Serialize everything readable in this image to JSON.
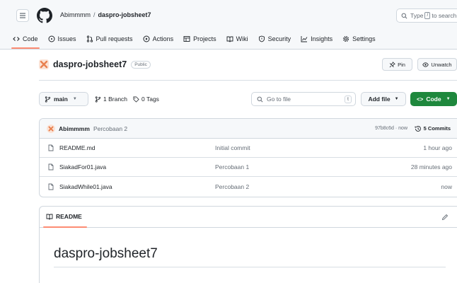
{
  "header": {
    "owner": "Abimmmm",
    "separator": "/",
    "repo": "daspro-jobsheet7",
    "search_prefix": "Type",
    "search_key": "/",
    "search_suffix": "to search"
  },
  "nav": {
    "tabs": [
      {
        "label": "Code",
        "icon": "code-icon",
        "active": true
      },
      {
        "label": "Issues",
        "icon": "issue-icon"
      },
      {
        "label": "Pull requests",
        "icon": "pull-request-icon"
      },
      {
        "label": "Actions",
        "icon": "play-icon"
      },
      {
        "label": "Projects",
        "icon": "table-icon"
      },
      {
        "label": "Wiki",
        "icon": "book-icon"
      },
      {
        "label": "Security",
        "icon": "shield-icon"
      },
      {
        "label": "Insights",
        "icon": "graph-icon"
      },
      {
        "label": "Settings",
        "icon": "gear-icon"
      }
    ]
  },
  "repo": {
    "name": "daspro-jobsheet7",
    "visibility": "Public",
    "pin_label": "Pin",
    "watch_label": "Unwatch"
  },
  "branch": {
    "name": "main",
    "branch_count": "1 Branch",
    "tag_count": "0 Tags",
    "goto_placeholder": "Go to file",
    "goto_key": "t",
    "add_file": "Add file",
    "code": "Code"
  },
  "latest_commit": {
    "author": "Abimmmm",
    "message": "Percobaan 2",
    "hash_time": "97b8c6d · now",
    "commits": "5 Commits"
  },
  "files": [
    {
      "name": "README.md",
      "message": "Initial commit",
      "time": "1 hour ago"
    },
    {
      "name": "SiakadFor01.java",
      "message": "Percobaan 1",
      "time": "28 minutes ago"
    },
    {
      "name": "SiakadWhile01.java",
      "message": "Percobaan 2",
      "time": "now"
    }
  ],
  "readme": {
    "tab_label": "README",
    "heading": "daspro-jobsheet7"
  },
  "colors": {
    "accent_underline": "#fd8c73",
    "code_button": "#1f883d",
    "avatar": "#e8804f"
  }
}
